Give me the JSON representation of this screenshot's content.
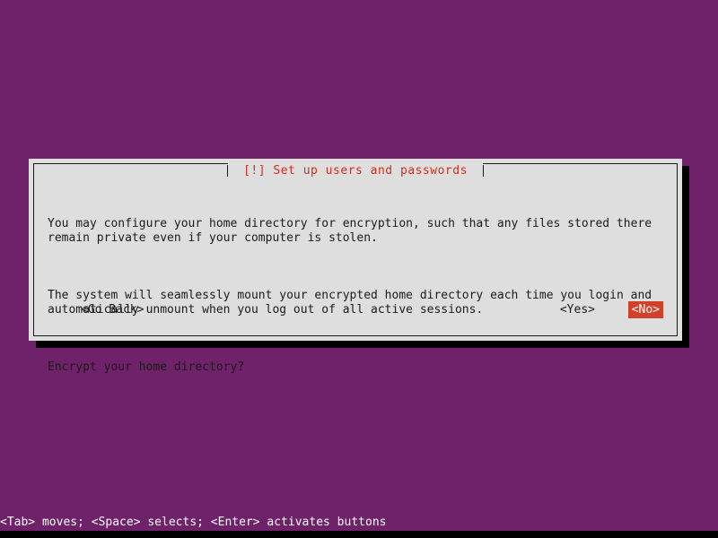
{
  "screen": {
    "background_color": "#6f2169",
    "bottom_bar_color": "#000000"
  },
  "dialog": {
    "title": "[!] Set up users and passwords",
    "title_color": "#cf2d1f",
    "background_color": "#dedede",
    "border_color": "#1a1a1a",
    "shadow_color": "#000000",
    "paragraphs": [
      "You may configure your home directory for encryption, such that any files stored there\nremain private even if your computer is stolen.",
      "The system will seamlessly mount your encrypted home directory each time you login and\nautomatically unmount when you log out of all active sessions.",
      "Encrypt your home directory?"
    ],
    "buttons": [
      {
        "label": "<Go Back>",
        "selected": false
      },
      {
        "label": "<Yes>",
        "selected": false
      },
      {
        "label": "<No>",
        "selected": true
      }
    ],
    "selected_button_bg": "#d3402a",
    "selected_button_fg": "#ffffff"
  },
  "statusbar": {
    "text": "<Tab> moves; <Space> selects; <Enter> activates buttons",
    "color": "#ffffff"
  }
}
